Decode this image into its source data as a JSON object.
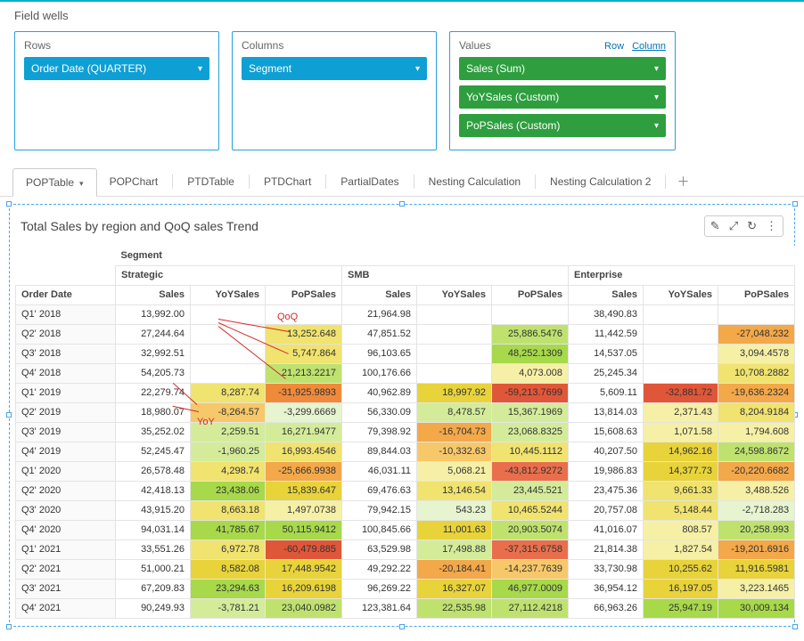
{
  "fieldWells": {
    "title": "Field wells",
    "rows": {
      "label": "Rows",
      "items": [
        "Order Date (QUARTER)"
      ]
    },
    "columns": {
      "label": "Columns",
      "items": [
        "Segment"
      ]
    },
    "values": {
      "label": "Values",
      "rowLink": "Row",
      "colLink": "Column",
      "items": [
        "Sales (Sum)",
        "YoYSales (Custom)",
        "PoPSales (Custom)"
      ]
    }
  },
  "tabs": {
    "items": [
      "POPTable",
      "POPChart",
      "PTDTable",
      "PTDChart",
      "PartialDates",
      "Nesting Calculation",
      "Nesting Calculation 2"
    ],
    "activeIndex": 0
  },
  "viz": {
    "title": "Total Sales by region and QoQ sales Trend",
    "tools": [
      "✎",
      "⤢",
      "↻",
      "⋮"
    ],
    "segmentLabel": "Segment",
    "orderDateLabel": "Order Date",
    "segments": [
      "Strategic",
      "SMB",
      "Enterprise"
    ],
    "subcols": [
      "Sales",
      "YoYSales",
      "PoPSales"
    ],
    "annotations": {
      "qoq": "QoQ",
      "yoy": "YoY"
    }
  },
  "chart_data": {
    "type": "table",
    "row_field": "Order Date (QUARTER)",
    "column_field": "Segment",
    "measures": [
      "Sales",
      "YoYSales",
      "PoPSales"
    ],
    "segments": [
      "Strategic",
      "SMB",
      "Enterprise"
    ],
    "rows": [
      {
        "label": "Q1' 2018",
        "Strategic": {
          "Sales": "13,992.00",
          "YoYSales": "",
          "PoPSales": ""
        },
        "SMB": {
          "Sales": "21,964.98",
          "YoYSales": "",
          "PoPSales": ""
        },
        "Enterprise": {
          "Sales": "38,490.83",
          "YoYSales": "",
          "PoPSales": ""
        }
      },
      {
        "label": "Q2' 2018",
        "Strategic": {
          "Sales": "27,244.64",
          "YoYSales": "",
          "PoPSales": "13,252.648"
        },
        "SMB": {
          "Sales": "47,851.52",
          "YoYSales": "",
          "PoPSales": "25,886.5476"
        },
        "Enterprise": {
          "Sales": "11,442.59",
          "YoYSales": "",
          "PoPSales": "-27,048.232"
        }
      },
      {
        "label": "Q3' 2018",
        "Strategic": {
          "Sales": "32,992.51",
          "YoYSales": "",
          "PoPSales": "5,747.864"
        },
        "SMB": {
          "Sales": "96,103.65",
          "YoYSales": "",
          "PoPSales": "48,252.1309"
        },
        "Enterprise": {
          "Sales": "14,537.05",
          "YoYSales": "",
          "PoPSales": "3,094.4578"
        }
      },
      {
        "label": "Q4' 2018",
        "Strategic": {
          "Sales": "54,205.73",
          "YoYSales": "",
          "PoPSales": "21,213.2217"
        },
        "SMB": {
          "Sales": "100,176.66",
          "YoYSales": "",
          "PoPSales": "4,073.008"
        },
        "Enterprise": {
          "Sales": "25,245.34",
          "YoYSales": "",
          "PoPSales": "10,708.2882"
        }
      },
      {
        "label": "Q1' 2019",
        "Strategic": {
          "Sales": "22,279.74",
          "YoYSales": "8,287.74",
          "PoPSales": "-31,925.9893"
        },
        "SMB": {
          "Sales": "40,962.89",
          "YoYSales": "18,997.92",
          "PoPSales": "-59,213.7699"
        },
        "Enterprise": {
          "Sales": "5,609.11",
          "YoYSales": "-32,881.72",
          "PoPSales": "-19,636.2324"
        }
      },
      {
        "label": "Q2' 2019",
        "Strategic": {
          "Sales": "18,980.07",
          "YoYSales": "-8,264.57",
          "PoPSales": "-3,299.6669"
        },
        "SMB": {
          "Sales": "56,330.09",
          "YoYSales": "8,478.57",
          "PoPSales": "15,367.1969"
        },
        "Enterprise": {
          "Sales": "13,814.03",
          "YoYSales": "2,371.43",
          "PoPSales": "8,204.9184"
        }
      },
      {
        "label": "Q3' 2019",
        "Strategic": {
          "Sales": "35,252.02",
          "YoYSales": "2,259.51",
          "PoPSales": "16,271.9477"
        },
        "SMB": {
          "Sales": "79,398.92",
          "YoYSales": "-16,704.73",
          "PoPSales": "23,068.8325"
        },
        "Enterprise": {
          "Sales": "15,608.63",
          "YoYSales": "1,071.58",
          "PoPSales": "1,794.608"
        }
      },
      {
        "label": "Q4' 2019",
        "Strategic": {
          "Sales": "52,245.47",
          "YoYSales": "-1,960.25",
          "PoPSales": "16,993.4546"
        },
        "SMB": {
          "Sales": "89,844.03",
          "YoYSales": "-10,332.63",
          "PoPSales": "10,445.1112"
        },
        "Enterprise": {
          "Sales": "40,207.50",
          "YoYSales": "14,962.16",
          "PoPSales": "24,598.8672"
        }
      },
      {
        "label": "Q1' 2020",
        "Strategic": {
          "Sales": "26,578.48",
          "YoYSales": "4,298.74",
          "PoPSales": "-25,666.9938"
        },
        "SMB": {
          "Sales": "46,031.11",
          "YoYSales": "5,068.21",
          "PoPSales": "-43,812.9272"
        },
        "Enterprise": {
          "Sales": "19,986.83",
          "YoYSales": "14,377.73",
          "PoPSales": "-20,220.6682"
        }
      },
      {
        "label": "Q2' 2020",
        "Strategic": {
          "Sales": "42,418.13",
          "YoYSales": "23,438.06",
          "PoPSales": "15,839.647"
        },
        "SMB": {
          "Sales": "69,476.63",
          "YoYSales": "13,146.54",
          "PoPSales": "23,445.521"
        },
        "Enterprise": {
          "Sales": "23,475.36",
          "YoYSales": "9,661.33",
          "PoPSales": "3,488.526"
        }
      },
      {
        "label": "Q3' 2020",
        "Strategic": {
          "Sales": "43,915.20",
          "YoYSales": "8,663.18",
          "PoPSales": "1,497.0738"
        },
        "SMB": {
          "Sales": "79,942.15",
          "YoYSales": "543.23",
          "PoPSales": "10,465.5244"
        },
        "Enterprise": {
          "Sales": "20,757.08",
          "YoYSales": "5,148.44",
          "PoPSales": "-2,718.283"
        }
      },
      {
        "label": "Q4' 2020",
        "Strategic": {
          "Sales": "94,031.14",
          "YoYSales": "41,785.67",
          "PoPSales": "50,115.9412"
        },
        "SMB": {
          "Sales": "100,845.66",
          "YoYSales": "11,001.63",
          "PoPSales": "20,903.5074"
        },
        "Enterprise": {
          "Sales": "41,016.07",
          "YoYSales": "808.57",
          "PoPSales": "20,258.993"
        }
      },
      {
        "label": "Q1' 2021",
        "Strategic": {
          "Sales": "33,551.26",
          "YoYSales": "6,972.78",
          "PoPSales": "-60,479.885"
        },
        "SMB": {
          "Sales": "63,529.98",
          "YoYSales": "17,498.88",
          "PoPSales": "-37,315.6758"
        },
        "Enterprise": {
          "Sales": "21,814.38",
          "YoYSales": "1,827.54",
          "PoPSales": "-19,201.6916"
        }
      },
      {
        "label": "Q2' 2021",
        "Strategic": {
          "Sales": "51,000.21",
          "YoYSales": "8,582.08",
          "PoPSales": "17,448.9542"
        },
        "SMB": {
          "Sales": "49,292.22",
          "YoYSales": "-20,184.41",
          "PoPSales": "-14,237.7639"
        },
        "Enterprise": {
          "Sales": "33,730.98",
          "YoYSales": "10,255.62",
          "PoPSales": "11,916.5981"
        }
      },
      {
        "label": "Q3' 2021",
        "Strategic": {
          "Sales": "67,209.83",
          "YoYSales": "23,294.63",
          "PoPSales": "16,209.6198"
        },
        "SMB": {
          "Sales": "96,269.22",
          "YoYSales": "16,327.07",
          "PoPSales": "46,977.0009"
        },
        "Enterprise": {
          "Sales": "36,954.12",
          "YoYSales": "16,197.05",
          "PoPSales": "3,223.1465"
        }
      },
      {
        "label": "Q4' 2021",
        "Strategic": {
          "Sales": "90,249.93",
          "YoYSales": "-3,781.21",
          "PoPSales": "23,040.0982"
        },
        "SMB": {
          "Sales": "123,381.64",
          "YoYSales": "22,535.98",
          "PoPSales": "27,112.4218"
        },
        "Enterprise": {
          "Sales": "66,963.26",
          "YoYSales": "25,947.19",
          "PoPSales": "30,009.134"
        }
      }
    ]
  },
  "heat": {
    "Q1' 2018": [
      "c-none",
      "c-none",
      "c-none",
      "c-none",
      "c-none",
      "c-none",
      "c-none",
      "c-none",
      "c-none"
    ],
    "Q2' 2018": [
      "c-none",
      "c-none",
      "c-y2",
      "c-none",
      "c-none",
      "c-g3",
      "c-none",
      "c-none",
      "c-o2"
    ],
    "Q3' 2018": [
      "c-none",
      "c-none",
      "c-y2",
      "c-none",
      "c-none",
      "c-g4",
      "c-none",
      "c-none",
      "c-y1"
    ],
    "Q4' 2018": [
      "c-none",
      "c-none",
      "c-g3",
      "c-none",
      "c-none",
      "c-y1",
      "c-none",
      "c-none",
      "c-y2"
    ],
    "Q1' 2019": [
      "c-none",
      "c-y2",
      "c-o3",
      "c-none",
      "c-y3",
      "c-r2",
      "c-none",
      "c-r2",
      "c-o2"
    ],
    "Q2' 2019": [
      "c-none",
      "c-o1",
      "c-g1",
      "c-none",
      "c-g2",
      "c-g2",
      "c-none",
      "c-y1",
      "c-y2"
    ],
    "Q3' 2019": [
      "c-none",
      "c-g2",
      "c-g2",
      "c-none",
      "c-o2",
      "c-g2",
      "c-none",
      "c-y1",
      "c-y1"
    ],
    "Q4' 2019": [
      "c-none",
      "c-g2",
      "c-y2",
      "c-none",
      "c-o1",
      "c-y2",
      "c-none",
      "c-y3",
      "c-g3"
    ],
    "Q1' 2020": [
      "c-none",
      "c-y2",
      "c-o2",
      "c-none",
      "c-y1",
      "c-r1",
      "c-none",
      "c-y3",
      "c-o2"
    ],
    "Q2' 2020": [
      "c-none",
      "c-g4",
      "c-y3",
      "c-none",
      "c-y2",
      "c-g2",
      "c-none",
      "c-y2",
      "c-y1"
    ],
    "Q3' 2020": [
      "c-none",
      "c-y2",
      "c-y1",
      "c-none",
      "c-g1",
      "c-y2",
      "c-none",
      "c-y2",
      "c-g1"
    ],
    "Q4' 2020": [
      "c-none",
      "c-g4",
      "c-g4",
      "c-none",
      "c-y3",
      "c-g3",
      "c-none",
      "c-y1",
      "c-g3"
    ],
    "Q1' 2021": [
      "c-none",
      "c-y2",
      "c-r2",
      "c-none",
      "c-g2",
      "c-r1",
      "c-none",
      "c-y1",
      "c-o2"
    ],
    "Q2' 2021": [
      "c-none",
      "c-y3",
      "c-y3",
      "c-none",
      "c-o2",
      "c-o1",
      "c-none",
      "c-y3",
      "c-y3"
    ],
    "Q3' 2021": [
      "c-none",
      "c-g4",
      "c-y3",
      "c-none",
      "c-y3",
      "c-g4",
      "c-none",
      "c-y3",
      "c-y1"
    ],
    "Q4' 2021": [
      "c-none",
      "c-g2",
      "c-g3",
      "c-none",
      "c-g3",
      "c-g3",
      "c-none",
      "c-g4",
      "c-g4"
    ]
  }
}
